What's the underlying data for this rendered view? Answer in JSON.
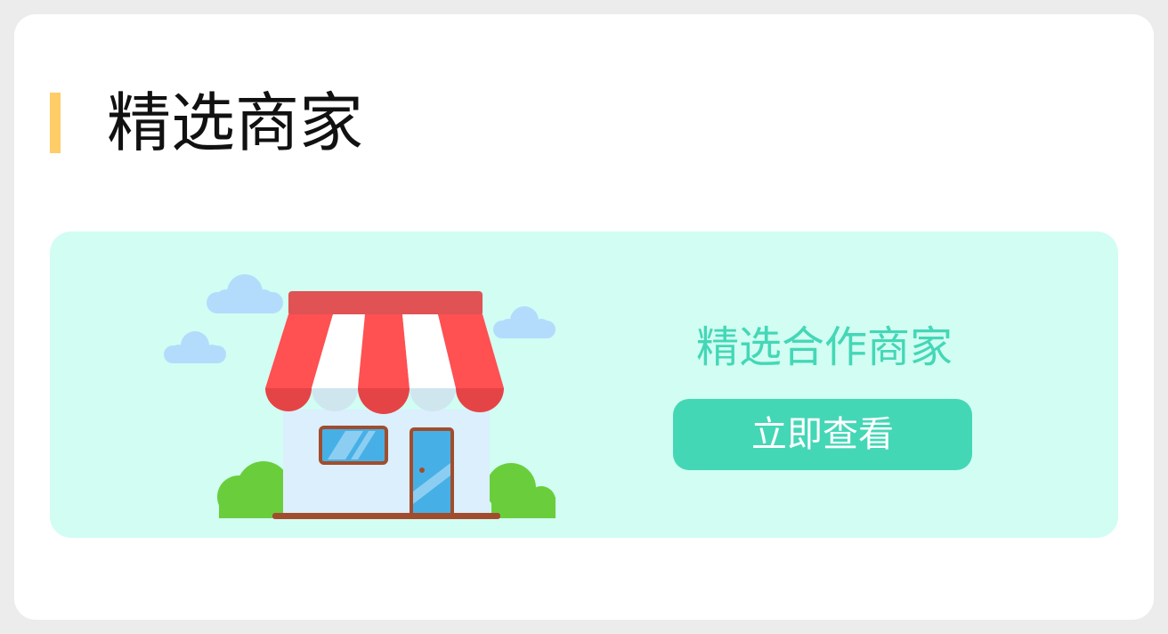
{
  "section": {
    "title": "精选商家",
    "accent_color": "#fecd67"
  },
  "banner": {
    "background": "#d1fdf3",
    "promo_text": "精选合作商家",
    "button_label": "立即查看",
    "accent_color": "#44d7b6",
    "illustration_icon": "storefront-icon"
  }
}
